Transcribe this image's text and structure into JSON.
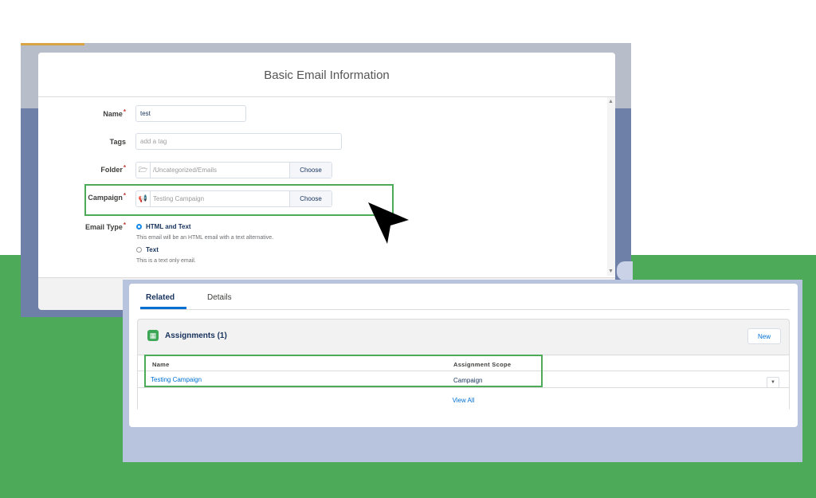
{
  "modal": {
    "title": "Basic Email Information",
    "fields": {
      "name": {
        "label": "Name",
        "value": "test",
        "required": "*"
      },
      "tags": {
        "label": "Tags",
        "placeholder": "add a tag"
      },
      "folder": {
        "label": "Folder",
        "value": "/Uncategorized/Emails",
        "button": "Choose",
        "required": "*",
        "icon": "folder-icon"
      },
      "campaign": {
        "label": "Campaign",
        "value": "Testing Campaign",
        "button": "Choose",
        "required": "*",
        "icon": "megaphone-icon"
      },
      "email_type": {
        "label": "Email Type",
        "required": "*",
        "options": [
          {
            "label": "HTML and Text",
            "help": "This email will be an HTML email with a text alternative.",
            "checked": true
          },
          {
            "label": "Text",
            "help": "This is a text only email.",
            "checked": false
          }
        ]
      }
    }
  },
  "related": {
    "tabs": [
      "Related",
      "Details"
    ],
    "card": {
      "title": "Assignments (1)",
      "new_label": "New",
      "columns": [
        "Name",
        "Assignment Scope"
      ],
      "rows": [
        {
          "name": "Testing Campaign",
          "scope": "Campaign"
        }
      ],
      "view_all": "View All"
    }
  },
  "colors": {
    "highlight": "#4caa58",
    "link": "#0070d2",
    "radio": "#1589ee"
  }
}
